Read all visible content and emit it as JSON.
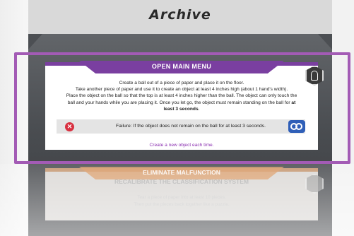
{
  "archive": {
    "title": "Archive"
  },
  "active_card": {
    "title": "OPEN MAIN MENU",
    "line1": "Create a ball out of a piece of paper and place it on the floor.",
    "line2": "Take another piece of paper and use it to create an object at least 4 inches high (about 1 hand's width).",
    "line3": "Place the object on the ball so that the top is at least 4 inches higher than the ball. The object can only touch the",
    "line4": "ball and your hands while you are placing it. Once you let go, the object must remain standing on the ball for",
    "line4_bold": "at",
    "line5_bold": "least 3 seconds",
    "line5_end": ".",
    "failure_text": "Failure: If the object does not remain on the ball for at least 3 seconds.",
    "create_link": "Create a new object each time.",
    "fail_icon": "x-circle-icon",
    "reset_icon": "swap-icon",
    "badge_icon": "lock-icon",
    "accent_color": "#7a3fa0"
  },
  "next_card": {
    "title": "ELIMINATE MALFUNCTION",
    "subtitle": "RECALIBRATE THE CLASSIFICATION SYSTEM",
    "line1": "Tear a piece of paper into at least 10 pieces.",
    "line2": "Then put the pieces back together like a puzzle.",
    "accent_color": "#d8955c"
  },
  "selection_color": "#a35bb5"
}
